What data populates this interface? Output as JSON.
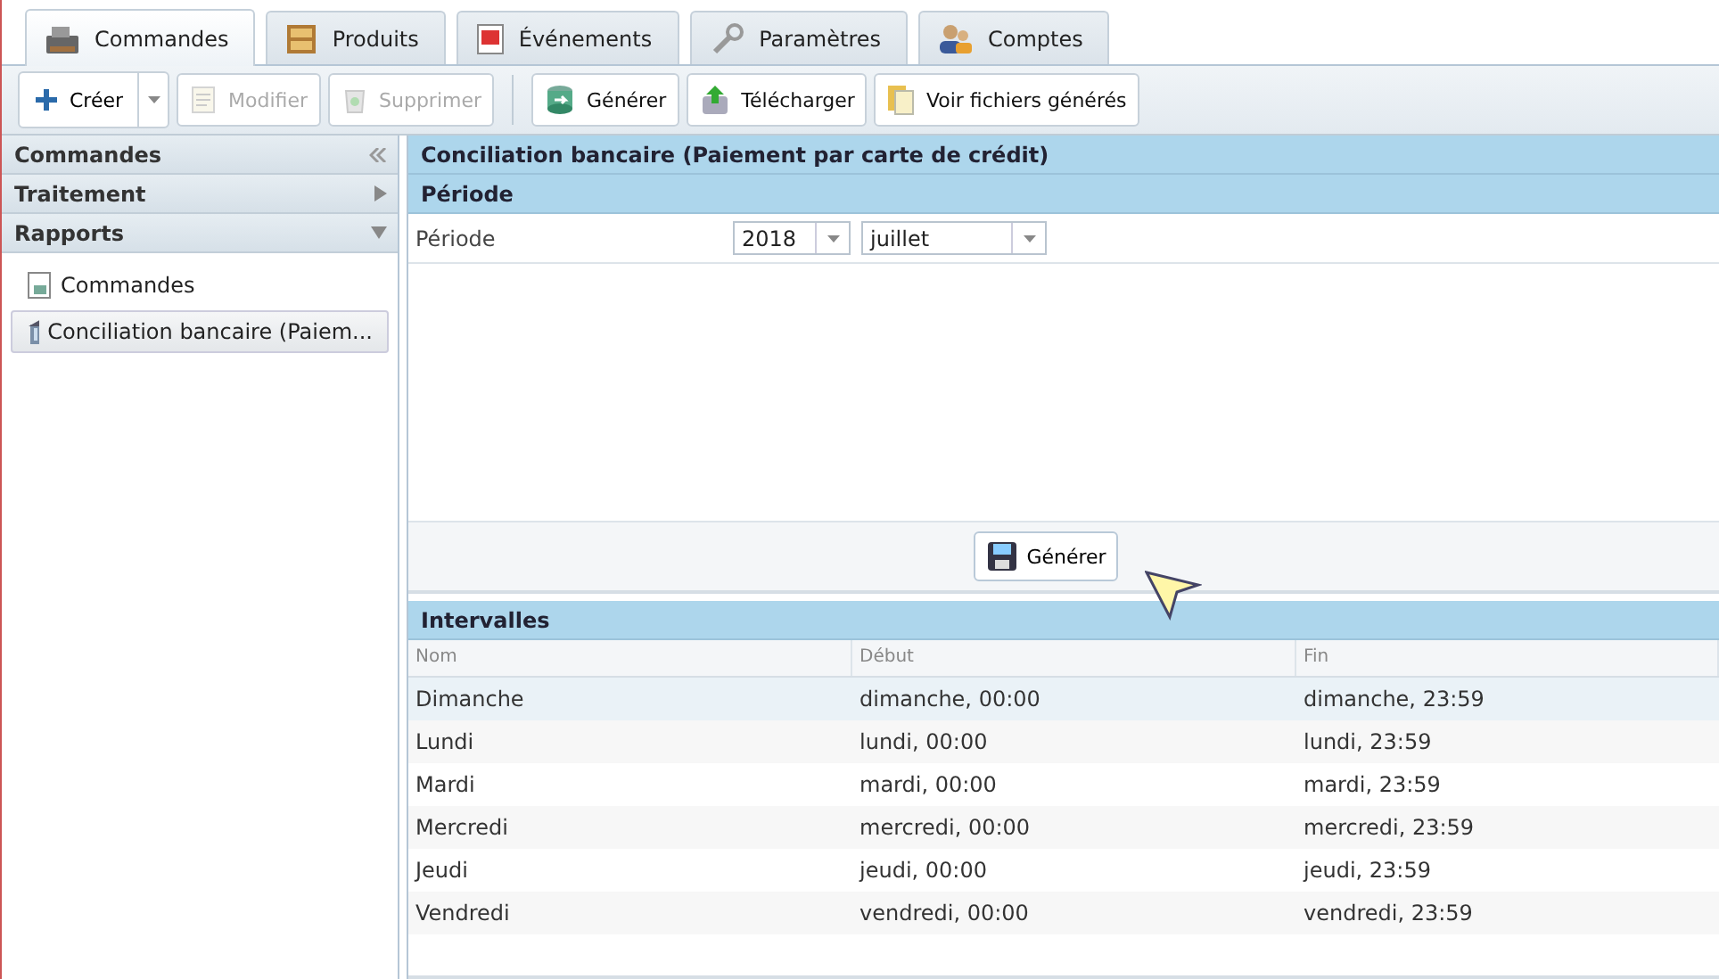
{
  "tabs": [
    {
      "label": "Commandes",
      "selected": true
    },
    {
      "label": "Produits",
      "selected": false
    },
    {
      "label": "Événements",
      "selected": false
    },
    {
      "label": "Paramètres",
      "selected": false
    },
    {
      "label": "Comptes",
      "selected": false
    }
  ],
  "toolbar": [
    {
      "label": "Créer",
      "kind": "split",
      "disabled": false
    },
    {
      "label": "Modifier",
      "kind": "plain",
      "disabled": true
    },
    {
      "label": "Supprimer",
      "kind": "plain",
      "disabled": true
    },
    {
      "kind": "separator"
    },
    {
      "label": "Générer",
      "kind": "plain",
      "disabled": false
    },
    {
      "label": "Télécharger",
      "kind": "plain",
      "disabled": false
    },
    {
      "label": "Voir fichiers générés",
      "kind": "plain",
      "disabled": false
    }
  ],
  "sidebar": {
    "title": "Commandes",
    "sections": [
      {
        "title": "Traitement",
        "expanded": false
      },
      {
        "title": "Rapports",
        "expanded": true,
        "items": [
          {
            "label": "Commandes",
            "selected": false
          },
          {
            "label": "Conciliation bancaire (Paiem...",
            "selected": true
          }
        ]
      }
    ]
  },
  "report": {
    "title": "Conciliation bancaire (Paiement par carte de crédit)",
    "section": "Période",
    "field": {
      "label": "Période",
      "year": "2018",
      "month": "juillet"
    },
    "button": "Générer"
  },
  "intervals": {
    "title": "Intervalles",
    "columns": [
      "Nom",
      "Début",
      "Fin"
    ],
    "rows": [
      {
        "cells": [
          "Dimanche",
          "dimanche, 00:00",
          "dimanche, 23:59"
        ],
        "selected": true
      },
      {
        "cells": [
          "Lundi",
          "lundi, 00:00",
          "lundi, 23:59"
        ],
        "selected": false
      },
      {
        "cells": [
          "Mardi",
          "mardi, 00:00",
          "mardi, 23:59"
        ],
        "selected": false
      },
      {
        "cells": [
          "Mercredi",
          "mercredi, 00:00",
          "mercredi, 23:59"
        ],
        "selected": false
      },
      {
        "cells": [
          "Jeudi",
          "jeudi, 00:00",
          "jeudi, 23:59"
        ],
        "selected": false
      },
      {
        "cells": [
          "Vendredi",
          "vendredi, 00:00",
          "vendredi, 23:59"
        ],
        "selected": false
      }
    ]
  }
}
